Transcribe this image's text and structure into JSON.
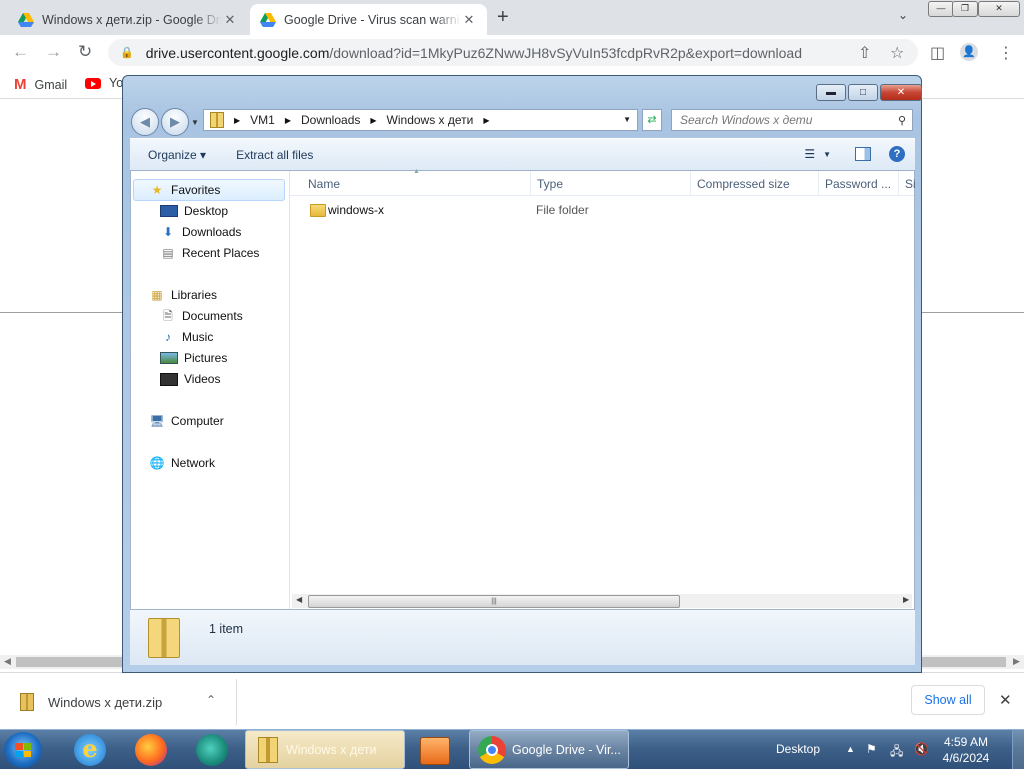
{
  "browser": {
    "tabs": [
      {
        "title": "Windows x дети.zip - Google Drive",
        "close": "✕",
        "active": false
      },
      {
        "title": "Google Drive - Virus scan warning",
        "close": "✕",
        "active": true
      }
    ],
    "new_tab": "+",
    "url_host": "drive.usercontent.google.com",
    "url_path": "/download?id=1MkyPuz6ZNwwJH8vSyVuIn53fcdpRvR2p&export=download",
    "bookmarks": [
      {
        "label": "Gmail",
        "icon": "gmail-icon"
      },
      {
        "label": "Yo",
        "icon": "youtube-icon"
      }
    ],
    "download": {
      "file": "Windows x дети.zip",
      "show_all": "Show all"
    }
  },
  "explorer": {
    "breadcrumb": [
      "VM1",
      "Downloads",
      "Windows x дети"
    ],
    "search_placeholder": "Search Windows x дети",
    "commands": [
      "Organize",
      "Extract all files"
    ],
    "nav": {
      "favorites": "Favorites",
      "favorites_items": [
        "Desktop",
        "Downloads",
        "Recent Places"
      ],
      "libraries": "Libraries",
      "libraries_items": [
        "Documents",
        "Music",
        "Pictures",
        "Videos"
      ],
      "computer": "Computer",
      "network": "Network"
    },
    "columns": [
      "Name",
      "Type",
      "Compressed size",
      "Password ...",
      "Si"
    ],
    "rows": [
      {
        "name": "windows-x",
        "type": "File folder"
      }
    ],
    "status": "1 item"
  },
  "taskbar": {
    "explorer_task": "Windows x дети",
    "chrome_task": "Google Drive - Vir...",
    "desktop": "Desktop",
    "time": "4:59 AM",
    "date": "4/6/2024"
  },
  "colors": {
    "accent": "#1a73e8",
    "taskbar": "#3e6189",
    "window_frame": "#a9c4e2"
  }
}
